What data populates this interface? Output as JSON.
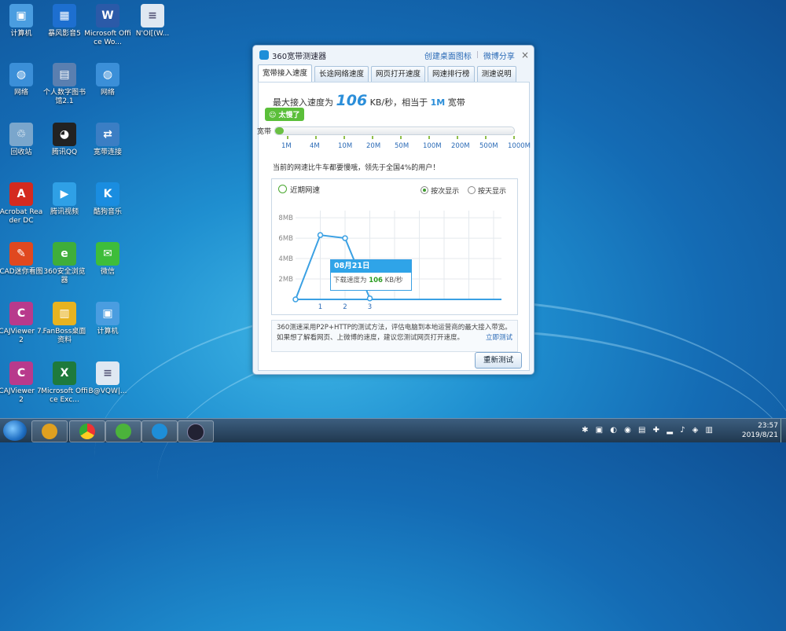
{
  "desktop_icons": [
    {
      "label": "计算机",
      "color": "#4a9de0",
      "glyph": "▣"
    },
    {
      "label": "暴风影音5",
      "color": "#1d6fd0",
      "glyph": "▦"
    },
    {
      "label": "Microsoft Office Wo...",
      "color": "#2b5aa8",
      "glyph": "W"
    },
    {
      "label": "N'OI[(W...",
      "color": "#dfe8f2",
      "glyph": "≡"
    },
    {
      "label": "网络",
      "color": "#3b8fd8",
      "glyph": "◍"
    },
    {
      "label": "个人数字图书馆2.1",
      "color": "#5a7fb0",
      "glyph": "▤"
    },
    {
      "label": "网络",
      "color": "#3b8fd8",
      "glyph": "◍"
    },
    {
      "label": "回收站",
      "color": "#7aa6cc",
      "glyph": "♲"
    },
    {
      "label": "腾讯QQ",
      "color": "#222",
      "glyph": "◕"
    },
    {
      "label": "宽带连接",
      "color": "#3b7ec4",
      "glyph": "⇄"
    },
    {
      "label": "Acrobat Reader DC",
      "color": "#d42a1f",
      "glyph": "A"
    },
    {
      "label": "腾讯视频",
      "color": "#2fa0e6",
      "glyph": "▶"
    },
    {
      "label": "酷狗音乐",
      "color": "#1a8de0",
      "glyph": "K"
    },
    {
      "label": "CAD迷你看图",
      "color": "#e0481f",
      "glyph": "✎"
    },
    {
      "label": "360安全浏览器",
      "color": "#3fae3a",
      "glyph": "e"
    },
    {
      "label": "微信",
      "color": "#3ebd3a",
      "glyph": "✉"
    },
    {
      "label": "CAJViewer 7.2",
      "color": "#b83a8c",
      "glyph": "C"
    },
    {
      "label": "FanBoss桌面资料",
      "color": "#e8b320",
      "glyph": "▥"
    },
    {
      "label": "计算机",
      "color": "#4a9de0",
      "glyph": "▣"
    },
    {
      "label": "CAJViewer 7.2",
      "color": "#b83a8c",
      "glyph": "C"
    },
    {
      "label": "Microsoft Office Exc...",
      "color": "#1e7a3c",
      "glyph": "X"
    },
    {
      "label": "B@VQW|...",
      "color": "#dfe8f2",
      "glyph": "≡"
    }
  ],
  "window": {
    "title": "360宽带测速器",
    "link_shortcut": "创建桌面图标",
    "link_share": "微博分享",
    "close": "×",
    "tabs": [
      "宽带接入速度",
      "长途网络速度",
      "网页打开速度",
      "网速排行榜",
      "测速说明"
    ],
    "max_speed_prefix": "最大接入速度为",
    "max_speed_value": "106",
    "max_speed_unit": "KB/秒，相当于",
    "equiv": "1M",
    "equiv_suffix": "宽带",
    "badge": "太慢了",
    "bar_label": "宽带",
    "bar_fraction": 0.035,
    "scale": [
      "1M",
      "4M",
      "10M",
      "20M",
      "50M",
      "100M",
      "200M",
      "500M",
      "1000M"
    ],
    "note": "当前的网速比牛车都要慢哦，领先于全国4%的用户！",
    "chart_header": "近期网速",
    "opt_times": "按次显示",
    "opt_days": "按天显示",
    "tooltip_date": "08月21日",
    "tooltip_text": "下载速度为",
    "tooltip_value": "106",
    "tooltip_unit": "KB/秒",
    "info_line1": "360测速采用P2P+HTTP的测试方法，评估电脑到本地运营商的最大接入带宽。",
    "info_line2": "如果想了解看网页、上微博的速度，建议您测试网页打开速度。",
    "info_link": "立即测试",
    "retest": "重新测试"
  },
  "chart_data": {
    "type": "line",
    "x": [
      0,
      1,
      2,
      3
    ],
    "y": [
      0,
      6.3,
      6.0,
      0.1
    ],
    "x_ticks": [
      "1",
      "2",
      "3"
    ],
    "y_ticks": [
      "2MB",
      "4MB",
      "6MB",
      "8MB"
    ],
    "ylim": [
      0,
      8.7
    ],
    "color": "#3aa0e3",
    "grid": true
  },
  "taskbar": {
    "time": "23:57",
    "date": "2019/8/21",
    "tray_icons": "✱ ▣ ◐ ◉ ▤ ✚ ▂ ♪ ◈ ▥"
  }
}
